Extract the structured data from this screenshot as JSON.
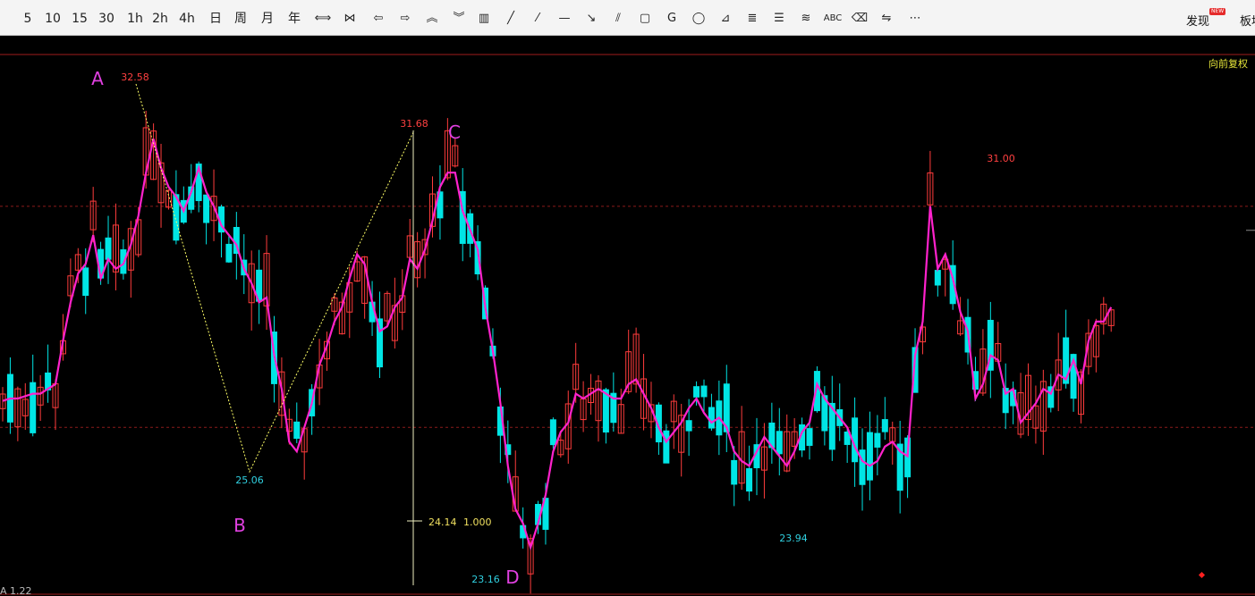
{
  "toolbar": {
    "periods": [
      "5",
      "10",
      "15",
      "30",
      "1h",
      "2h",
      "4h",
      "日",
      "周",
      "月",
      "年"
    ],
    "tools": [
      {
        "name": "expand-icon",
        "glyph": "⟺"
      },
      {
        "name": "shrink-icon",
        "glyph": "⋈"
      },
      {
        "name": "move-left-icon",
        "glyph": "⇦"
      },
      {
        "name": "move-right-icon",
        "glyph": "⇨"
      },
      {
        "name": "zoom-in-icon",
        "glyph": "︽"
      },
      {
        "name": "zoom-out-icon",
        "glyph": "︾"
      },
      {
        "name": "layout-icon",
        "glyph": "▥"
      },
      {
        "name": "line-segment-icon",
        "glyph": "╱"
      },
      {
        "name": "ray-icon",
        "glyph": "⁄"
      },
      {
        "name": "horizontal-line-icon",
        "glyph": "—"
      },
      {
        "name": "arrow-line-icon",
        "glyph": "↘"
      },
      {
        "name": "parallel-lines-icon",
        "glyph": "⫽"
      },
      {
        "name": "rectangle-icon",
        "glyph": "▢"
      },
      {
        "name": "golden-ratio-icon",
        "glyph": "G"
      },
      {
        "name": "ellipse-icon",
        "glyph": "◯"
      },
      {
        "name": "fan-icon",
        "glyph": "⊿"
      },
      {
        "name": "fibonacci-icon",
        "glyph": "≣"
      },
      {
        "name": "gann-icon",
        "glyph": "☰"
      },
      {
        "name": "wave-icon",
        "glyph": "≋"
      },
      {
        "name": "text-abc-icon",
        "glyph": "ABC"
      },
      {
        "name": "eraser-icon",
        "glyph": "⌫"
      },
      {
        "name": "adjust-icon",
        "glyph": "⇋"
      },
      {
        "name": "more-icon",
        "glyph": "⋯"
      }
    ],
    "discover_label": "发现",
    "new_badge": "NEW",
    "board_label": "板块"
  },
  "chart": {
    "mode_label": "向前复权",
    "bottom_label": "A 1.22",
    "crosshair_price": "24.14",
    "crosshair_ratio": "1.000",
    "colors": {
      "up": "#ff3c3c",
      "down": "#00e5e5",
      "ma": "#ff22cc",
      "annotation": "#e040e0",
      "grid": "#8b1a1a",
      "high_label": "#ff4040",
      "low_label": "#30d0e0",
      "crosshair": "#f0f0c0",
      "zigzag": "#ffff66"
    },
    "wave_labels": [
      {
        "label": "A"
      },
      {
        "label": "B"
      },
      {
        "label": "C"
      },
      {
        "label": "D"
      }
    ],
    "price_labels": [
      {
        "text": "32.58",
        "kind": "high"
      },
      {
        "text": "25.06",
        "kind": "low"
      },
      {
        "text": "31.68",
        "kind": "high"
      },
      {
        "text": "23.16",
        "kind": "low"
      },
      {
        "text": "23.94",
        "kind": "low"
      },
      {
        "text": "31.00",
        "kind": "high"
      }
    ]
  },
  "chart_data": {
    "type": "candlestick",
    "ylim": [
      22.9,
      33.2
    ],
    "grid_levels": [
      30.6,
      26.0
    ],
    "ma_close": [
      26.55,
      26.6,
      26.6,
      26.65,
      26.7,
      26.7,
      26.8,
      26.9,
      27.8,
      28.6,
      29.2,
      29.4,
      30.0,
      29.1,
      29.5,
      29.3,
      29.4,
      29.8,
      30.4,
      31.3,
      32.0,
      31.4,
      31.0,
      30.8,
      30.5,
      30.9,
      31.4,
      30.9,
      30.6,
      30.2,
      30.0,
      29.8,
      29.3,
      29.0,
      28.6,
      28.7,
      27.5,
      26.8,
      25.7,
      25.5,
      26.0,
      26.5,
      27.3,
      27.7,
      28.2,
      28.5,
      29.1,
      29.6,
      29.4,
      28.6,
      28.0,
      28.1,
      28.5,
      28.7,
      29.5,
      29.3,
      29.7,
      30.3,
      31.0,
      31.3,
      31.3,
      30.5,
      30.1,
      29.7,
      28.5,
      27.6,
      26.5,
      25.2,
      24.3,
      24.0,
      23.5,
      24.0,
      24.6,
      25.5,
      25.9,
      26.1,
      26.7,
      26.6,
      26.7,
      26.8,
      26.7,
      26.6,
      26.6,
      26.9,
      27.0,
      26.7,
      26.4,
      26.0,
      25.7,
      25.9,
      26.1,
      26.4,
      26.6,
      26.3,
      26.1,
      26.2,
      26.0,
      25.5,
      25.3,
      25.2,
      25.5,
      25.8,
      25.6,
      25.4,
      25.2,
      25.5,
      25.9,
      26.1,
      26.9,
      26.6,
      26.4,
      26.2,
      26.0,
      25.6,
      25.3,
      25.2,
      25.3,
      25.6,
      25.7,
      25.5,
      25.4,
      27.5,
      28.2,
      30.6,
      29.3,
      29.6,
      29.1,
      28.4,
      28.0,
      26.6,
      26.9,
      27.5,
      27.4,
      26.7,
      26.8,
      26.1,
      26.3,
      26.5,
      26.8,
      26.7,
      27.1,
      27.0,
      27.4,
      26.9,
      27.8,
      28.2,
      28.2,
      28.5
    ]
  }
}
